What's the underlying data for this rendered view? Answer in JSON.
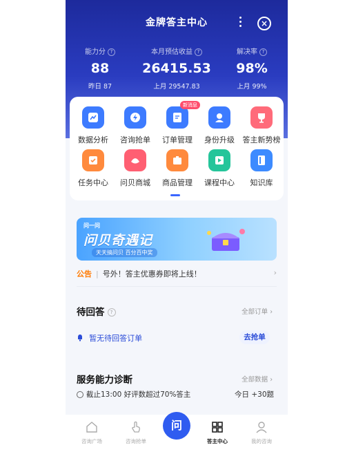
{
  "header": {
    "title": "金牌答主中心"
  },
  "stats": [
    {
      "label": "能力分",
      "value": "88",
      "sub": "昨日 87"
    },
    {
      "label": "本月预估收益",
      "value": "26415.53",
      "sub": "上月 29547.83"
    },
    {
      "label": "解决率",
      "value": "98%",
      "sub": "上月 99%"
    }
  ],
  "menu": {
    "items": [
      {
        "label": "数据分析",
        "color": "#3d7bff"
      },
      {
        "label": "咨询抢单",
        "color": "#3d7bff"
      },
      {
        "label": "订单管理",
        "color": "#3d7bff",
        "badge": "新消息"
      },
      {
        "label": "身份升级",
        "color": "#3d7bff"
      },
      {
        "label": "答主新势榜",
        "color": "#ff6b7a"
      },
      {
        "label": "任务中心",
        "color": "#ff8a3d"
      },
      {
        "label": "问贝商城",
        "color": "#ff5f72"
      },
      {
        "label": "商品管理",
        "color": "#ff8a3d"
      },
      {
        "label": "课程中心",
        "color": "#25c59a"
      },
      {
        "label": "知识库",
        "color": "#3d8bff"
      }
    ]
  },
  "banner": {
    "brand": "问一问",
    "headline": "问贝奇遇记",
    "slogan": "天天搞问贝 百分百中奖"
  },
  "notice": {
    "tag": "公告",
    "text": "号外！答主优惠券即将上线！"
  },
  "pending": {
    "title": "待回答",
    "link": "全部订单",
    "empty_text": "暂无待回答订单",
    "button": "去抢单"
  },
  "diagnosis": {
    "title": "服务能力诊断",
    "link": "全部数据",
    "text": "截止13:00 好评数超过70%答主",
    "right": "今日 +30题"
  },
  "tabbar": [
    {
      "label": "咨询广场"
    },
    {
      "label": "咨询抢单"
    },
    {
      "label": "问"
    },
    {
      "label": "答主中心"
    },
    {
      "label": "我的咨询"
    }
  ]
}
